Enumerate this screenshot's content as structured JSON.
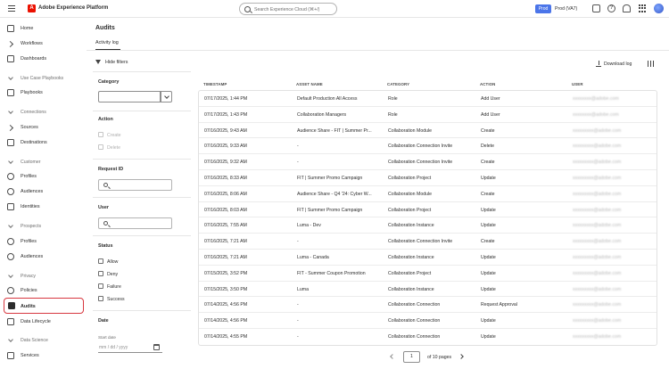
{
  "header": {
    "app_title": "Adobe Experience Platform",
    "logo_letter": "A",
    "search_placeholder": "Search Experience Cloud (⌘+/)",
    "env_badge": "Prod",
    "env_name": "Prod (VA7)",
    "icons": [
      "menu-icon",
      "adobe-logo",
      "search-icon",
      "chat-icon",
      "help-icon",
      "bell-icon",
      "apps-grid-icon",
      "avatar"
    ]
  },
  "sidebar": {
    "items": [
      {
        "label": "Home",
        "icon": "home-icon"
      },
      {
        "label": "Workflows",
        "icon": "workflows-icon"
      },
      {
        "label": "Dashboards",
        "icon": "dashboards-icon"
      },
      {
        "label": "Playbooks",
        "icon": "playbooks-icon"
      },
      {
        "label": "Sources",
        "icon": "sources-icon"
      },
      {
        "label": "Destinations",
        "icon": "destinations-icon"
      },
      {
        "label": "Profiles",
        "icon": "profiles-icon"
      },
      {
        "label": "Audiences",
        "icon": "audiences-icon"
      },
      {
        "label": "Identities",
        "icon": "identities-icon"
      },
      {
        "label": "Profiles",
        "icon": "profiles-icon"
      },
      {
        "label": "Audiences",
        "icon": "audiences-icon"
      },
      {
        "label": "Policies",
        "icon": "policies-icon"
      },
      {
        "label": "Audits",
        "icon": "audits-icon",
        "selected": true
      },
      {
        "label": "Data Lifecycle",
        "icon": "data-lifecycle-icon"
      },
      {
        "label": "Services",
        "icon": "services-icon"
      }
    ],
    "sections": [
      "Use Case Playbooks",
      "Connections",
      "Customer",
      "Prospects",
      "Privacy",
      "Data Science"
    ]
  },
  "page": {
    "title": "Audits",
    "tab_activity_log": "Activity log"
  },
  "filters": {
    "hide_label": "Hide filters",
    "category_label": "Category",
    "action_label": "Action",
    "action_create": "Create",
    "action_delete": "Delete",
    "request_id_label": "Request ID",
    "user_label": "User",
    "status_label": "Status",
    "status_allow": "Allow",
    "status_deny": "Deny",
    "status_failure": "Failure",
    "status_success": "Success",
    "date_label": "Date",
    "start_date_label": "Start date",
    "start_date_placeholder": "mm / dd / yyyy"
  },
  "toolbar": {
    "download_label": "Download log"
  },
  "table": {
    "columns": [
      "TIMESTAMP",
      "ASSET NAME",
      "CATEGORY",
      "ACTION",
      "USER"
    ],
    "rows": [
      [
        "07/17/2025, 1:44 PM",
        "Default Production All Access",
        "Role",
        "Add User",
        "xxxxxxxx@adobe.com"
      ],
      [
        "07/17/2025, 1:43 PM",
        "Collaboration Managers",
        "Role",
        "Add User",
        "xxxxxxxx@adobe.com"
      ],
      [
        "07/16/2025, 9:43 AM",
        "Audience Share - FIT | Summer Pr...",
        "Collaboration Module",
        "Create",
        "xxxxxxxxx@adobe.com"
      ],
      [
        "07/16/2025, 9:33 AM",
        "-",
        "Collaboration Connection Invite",
        "Delete",
        "xxxxxxxxx@adobe.com"
      ],
      [
        "07/16/2025, 9:32 AM",
        "-",
        "Collaboration Connection Invite",
        "Create",
        "xxxxxxxxx@adobe.com"
      ],
      [
        "07/16/2025, 8:33 AM",
        "FIT | Summer Promo Campaign",
        "Collaboration Project",
        "Update",
        "xxxxxxxxx@adobe.com"
      ],
      [
        "07/16/2025, 8:06 AM",
        "Audience Share - Q4 '24: Cyber W...",
        "Collaboration Module",
        "Create",
        "xxxxxxxxx@adobe.com"
      ],
      [
        "07/16/2025, 8:03 AM",
        "FIT | Summer Promo Campaign",
        "Collaboration Project",
        "Update",
        "xxxxxxxxx@adobe.com"
      ],
      [
        "07/16/2025, 7:55 AM",
        "Luma - Dev",
        "Collaboration Instance",
        "Update",
        "xxxxxxxxx@adobe.com"
      ],
      [
        "07/16/2025, 7:21 AM",
        "-",
        "Collaboration Connection Invite",
        "Create",
        "xxxxxxxxx@adobe.com"
      ],
      [
        "07/16/2025, 7:21 AM",
        "Luma - Canada",
        "Collaboration Instance",
        "Update",
        "xxxxxxxxx@adobe.com"
      ],
      [
        "07/15/2025, 3:52 PM",
        "FIT - Summer Coupon Promotion",
        "Collaboration Project",
        "Update",
        "xxxxxxxxx@adobe.com"
      ],
      [
        "07/15/2025, 3:50 PM",
        "Luma",
        "Collaboration Instance",
        "Update",
        "xxxxxxxxx@adobe.com"
      ],
      [
        "07/14/2025, 4:56 PM",
        "-",
        "Collaboration Connection",
        "Request Approval",
        "xxxxxxxxx@adobe.com"
      ],
      [
        "07/14/2025, 4:56 PM",
        "-",
        "Collaboration Connection",
        "Update",
        "xxxxxxxxx@adobe.com"
      ],
      [
        "07/14/2025, 4:55 PM",
        "-",
        "Collaboration Connection",
        "Update",
        "xxxxxxxxx@adobe.com"
      ]
    ]
  },
  "pagination": {
    "current_page": "1",
    "of_pages": "of 10 pages"
  }
}
